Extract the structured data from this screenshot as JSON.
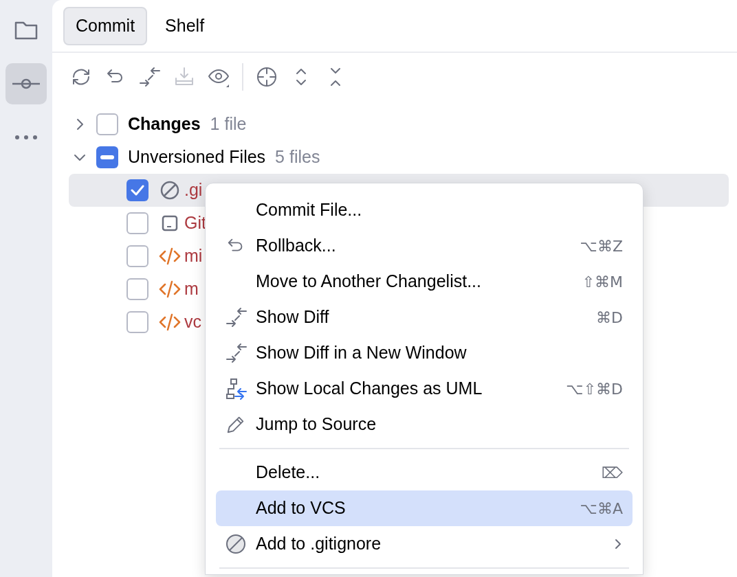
{
  "sidebar": {
    "items": [
      {
        "selected": false
      },
      {
        "selected": true
      },
      {
        "selected": false
      }
    ]
  },
  "tabs": [
    {
      "label": "Commit",
      "selected": true
    },
    {
      "label": "Shelf",
      "selected": false
    }
  ],
  "toolbar": {
    "buttons": [
      {
        "disabled": false
      },
      {
        "disabled": false
      },
      {
        "disabled": false
      },
      {
        "disabled": true
      },
      {
        "disabled": false
      },
      {
        "disabled": false
      },
      {
        "disabled": false
      },
      {
        "disabled": false
      }
    ]
  },
  "tree": [
    {
      "label": "Changes",
      "count": "1 file",
      "default": true,
      "expanded": false,
      "checked": false,
      "partial": false
    },
    {
      "label": "Unversioned Files",
      "count": "5 files",
      "default": false,
      "expanded": true,
      "partial": true,
      "children": [
        {
          "name": ".gi",
          "kind": "ignored",
          "checked": true,
          "selected": true
        },
        {
          "name": "Git",
          "kind": "text",
          "checked": false,
          "selected": false
        },
        {
          "name": "mi",
          "kind": "xml",
          "checked": false,
          "selected": false
        },
        {
          "name": "m",
          "kind": "xml",
          "checked": false,
          "selected": false
        },
        {
          "name": "vc",
          "kind": "xml",
          "checked": false,
          "selected": false
        }
      ]
    }
  ],
  "menu": {
    "sections": [
      [
        {
          "label": "Commit File...",
          "kind": "plain",
          "selected": false,
          "submenu": false
        },
        {
          "label": "Rollback...",
          "shortcut": "⌥⌘Z",
          "kind": "rollback",
          "selected": false,
          "submenu": false
        },
        {
          "label": "Move to Another Changelist...",
          "shortcut": "⇧⌘M",
          "kind": "plain",
          "selected": false,
          "submenu": false
        },
        {
          "label": "Show Diff",
          "shortcut": "⌘D",
          "kind": "diff",
          "selected": false,
          "submenu": false
        },
        {
          "label": "Show Diff in a New Window",
          "kind": "diff",
          "selected": false,
          "submenu": false
        },
        {
          "label": "Show Local Changes as UML",
          "shortcut": "⌥⇧⌘D",
          "kind": "uml",
          "selected": false,
          "submenu": false
        },
        {
          "label": "Jump to Source",
          "kind": "edit",
          "selected": false,
          "submenu": false
        }
      ],
      [
        {
          "label": "Delete...",
          "shortcut": "⌦",
          "kind": "plain",
          "selected": false,
          "submenu": false
        },
        {
          "label": "Add to VCS",
          "shortcut": "⌥⌘A",
          "kind": "plain",
          "selected": true,
          "submenu": false
        },
        {
          "label": "Add to .gitignore",
          "kind": "ignore",
          "selected": false,
          "submenu": true
        }
      ]
    ]
  }
}
